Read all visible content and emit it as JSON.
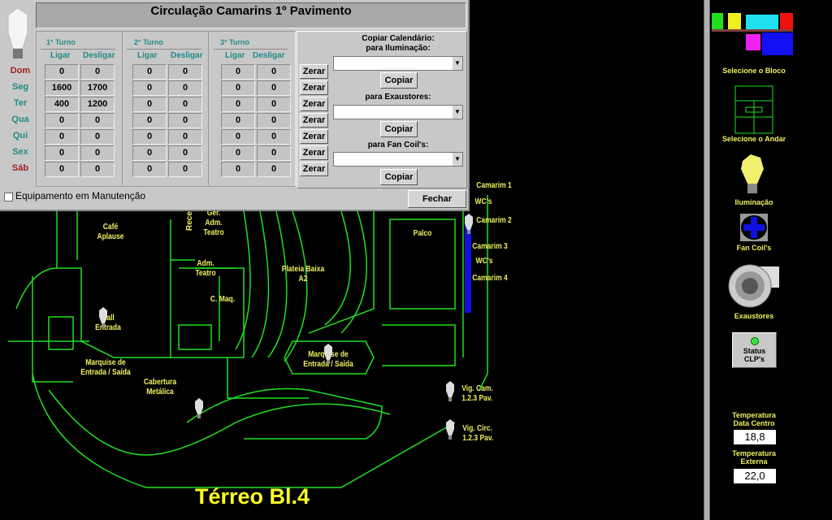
{
  "dialog": {
    "title": "Circulação Camarins 1º Pavimento",
    "turnos": [
      {
        "label": "1° Turno"
      },
      {
        "label": "2° Turno"
      },
      {
        "label": "3° Turno"
      }
    ],
    "col_ligar": "Ligar",
    "col_desligar": "Desligar",
    "days": [
      {
        "label": "Dom",
        "color": "#a02020"
      },
      {
        "label": "Seg",
        "color": "#208a8a"
      },
      {
        "label": "Ter",
        "color": "#208a8a"
      },
      {
        "label": "Qua",
        "color": "#208a8a"
      },
      {
        "label": "Qui",
        "color": "#208a8a"
      },
      {
        "label": "Sex",
        "color": "#208a8a"
      },
      {
        "label": "Sáb",
        "color": "#a02020"
      }
    ],
    "rows": [
      [
        "0",
        "0",
        "0",
        "0",
        "0",
        "0"
      ],
      [
        "1600",
        "1700",
        "0",
        "0",
        "0",
        "0"
      ],
      [
        "400",
        "1200",
        "0",
        "0",
        "0",
        "0"
      ],
      [
        "0",
        "0",
        "0",
        "0",
        "0",
        "0"
      ],
      [
        "0",
        "0",
        "0",
        "0",
        "0",
        "0"
      ],
      [
        "0",
        "0",
        "0",
        "0",
        "0",
        "0"
      ],
      [
        "0",
        "0",
        "0",
        "0",
        "0",
        "0"
      ]
    ],
    "zerar_label": "Zerar",
    "copy_title": "Copiar Calendário:",
    "copy_ilum": "para Iluminação:",
    "copy_exaust": "para Exaustores:",
    "copy_fan": "para Fan Coil's:",
    "copiar_label": "Copiar",
    "manutencao_label": "Equipamento em Manutenção",
    "manutencao_checked": false,
    "fechar_label": "Fechar"
  },
  "plan": {
    "title": "Térreo Bl.4",
    "labels": {
      "cafe": "Café\nAplause",
      "recep": "Recep",
      "ger": "Ger.\nAdm.\nTeatro",
      "adm": "Adm.\nTeatro",
      "plateia": "Plateia Baixa\nA2",
      "palco": "Palco",
      "cmaq": "C. Maq.",
      "hall": "Hall\nEntrada",
      "marq1": "Marquise de\nEntrada / Saída",
      "marq2": "Marquise de\nEntrada / Saída",
      "cobertura": "Cabertura\nMetálica",
      "cam1": "Camarim 1",
      "wc1": "WC's",
      "cam2": "Camarim 2",
      "cam3": "Camarim 3",
      "wc2": "WC's",
      "cam4": "Camarim 4",
      "vigcam": "Vig. Cam.\n1.2.3 Pav.",
      "vigcirc": "Vig. Circ.\n1.2.3 Pav."
    }
  },
  "sidebar": {
    "bloco": "Selecione o Bloco",
    "andar": "Selecione o Andar",
    "ilum": "Iluminação",
    "fan": "Fan Coil's",
    "exaust": "Exaustores",
    "status": "Status\nCLP's",
    "status_led": "#40e040",
    "temp_dc_label": "Temperatura\nData Centro",
    "temp_dc": "18,8",
    "temp_ext_label": "Temperatura\nExterna",
    "temp_ext": "22,0"
  },
  "colors": {
    "plan_line": "#20e020",
    "label": "#f0f060"
  }
}
